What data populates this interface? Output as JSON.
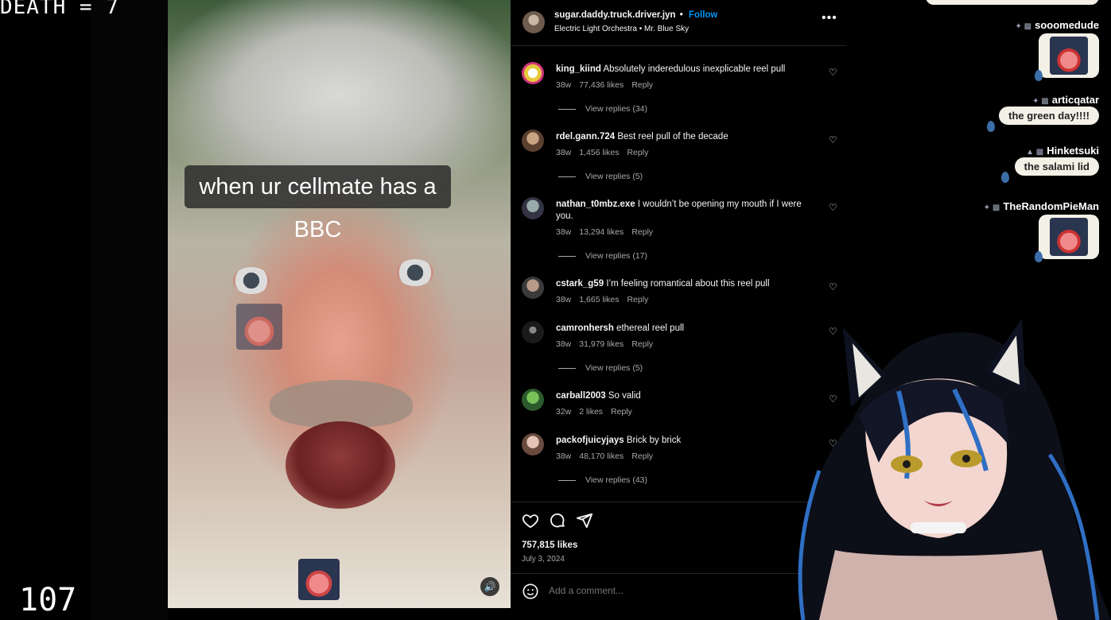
{
  "overlay": {
    "death_counter": "DEATH = 7",
    "bottom_number": "107"
  },
  "video": {
    "caption": "when ur cellmate has a BBC",
    "volume_icon": "speaker-icon"
  },
  "post": {
    "username": "sugar.daddy.truck.driver.jyn",
    "follow_label": "Follow",
    "song": "Electric Light Orchestra • Mr. Blue Sky",
    "likes": "757,815 likes",
    "date": "July 3, 2024",
    "add_comment_placeholder": "Add a comment..."
  },
  "comments": [
    {
      "user": "king_kiind",
      "text": "Absolutely inderedulous inexplicable reel pull",
      "age": "38w",
      "likes": "77,436 likes",
      "reply": "Reply",
      "replies": "View replies (34)"
    },
    {
      "user": "rdel.gann.724",
      "text": "Best reel pull of the decade",
      "age": "38w",
      "likes": "1,456 likes",
      "reply": "Reply",
      "replies": "View replies (5)"
    },
    {
      "user": "nathan_t0mbz.exe",
      "text": "I wouldn’t be opening my mouth if I were you.",
      "age": "38w",
      "likes": "13,294 likes",
      "reply": "Reply",
      "replies": "View replies (17)"
    },
    {
      "user": "cstark_g59",
      "text": "I’m feeling romantical about this reel pull",
      "age": "38w",
      "likes": "1,665 likes",
      "reply": "Reply",
      "replies": ""
    },
    {
      "user": "camronhersh",
      "text": "ethereal reel pull",
      "age": "38w",
      "likes": "31,979 likes",
      "reply": "Reply",
      "replies": "View replies (5)"
    },
    {
      "user": "carball2003",
      "text": "So valid",
      "age": "32w",
      "likes": "2 likes",
      "reply": "Reply",
      "replies": ""
    },
    {
      "user": "packofjuicyjays",
      "text": "Brick by brick",
      "age": "38w",
      "likes": "48,170 likes",
      "reply": "Reply",
      "replies": "View replies (43)"
    }
  ],
  "chat": [
    {
      "name": "sooomedude",
      "message": ""
    },
    {
      "name": "articqatar",
      "message": "the green day!!!!"
    },
    {
      "name": "Hinketsuki",
      "message": "the salami lid"
    },
    {
      "name": "TheRandomPieMan",
      "message": ""
    }
  ],
  "colors": {
    "accent_follow": "#0095f6",
    "chat_bubble": "#f3f1e6",
    "muted_text": "#a8a8a8"
  }
}
